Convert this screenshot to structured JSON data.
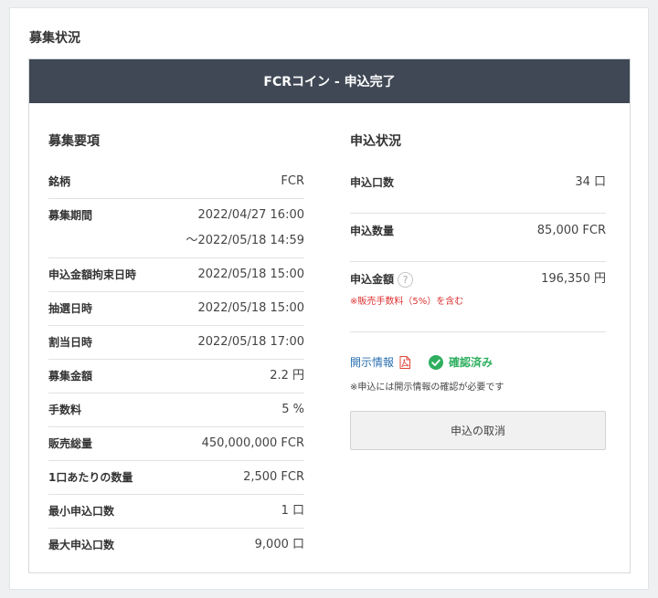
{
  "section_title": "募集状況",
  "panel_title": "FCRコイン - 申込完了",
  "offering": {
    "title": "募集要項",
    "rows": [
      {
        "label": "銘柄",
        "value": "FCR"
      },
      {
        "label": "募集期間",
        "value": "2022/04/27 16:00",
        "value2": "～2022/05/18 14:59"
      },
      {
        "label": "申込金額拘束日時",
        "value": "2022/05/18 15:00"
      },
      {
        "label": "抽選日時",
        "value": "2022/05/18 15:00"
      },
      {
        "label": "割当日時",
        "value": "2022/05/18 17:00"
      },
      {
        "label": "募集金額",
        "value": "2.2 円"
      },
      {
        "label": "手数料",
        "value": "5 %"
      },
      {
        "label": "販売総量",
        "value": "450,000,000 FCR"
      },
      {
        "label": "1口あたりの数量",
        "value": "2,500 FCR"
      },
      {
        "label": "最小申込口数",
        "value": "1 口"
      },
      {
        "label": "最大申込口数",
        "value": "9,000 口"
      }
    ]
  },
  "application": {
    "title": "申込状況",
    "units_label": "申込口数",
    "units_value": "34 口",
    "quantity_label": "申込数量",
    "quantity_value": "85,000 FCR",
    "amount_label": "申込金額",
    "amount_value": "196,350 円",
    "help_glyph": "?",
    "fee_note": "※販売手数料（5%）を含む"
  },
  "disclosure": {
    "link_label": "開示情報",
    "status_label": "確認済み",
    "note": "※申込には開示情報の確認が必要です"
  },
  "cancel_button": "申込の取消",
  "colors": {
    "header_bg": "#3f4854",
    "confirmed_green": "#2eaf5f",
    "link_blue": "#2a6fb0",
    "note_red": "#d33333",
    "pdf_red": "#e0453a"
  }
}
